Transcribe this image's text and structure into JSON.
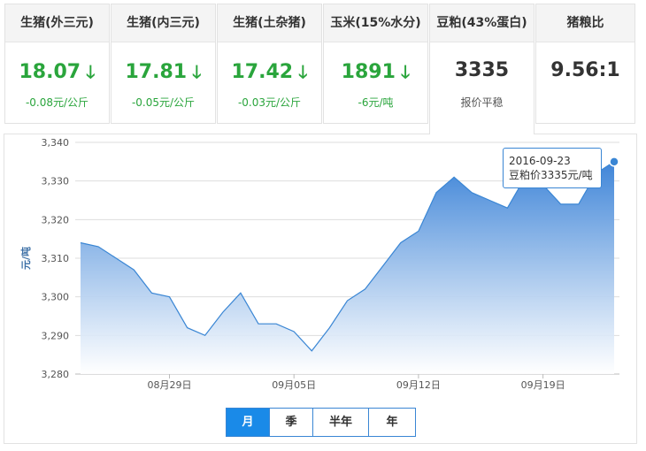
{
  "cards": [
    {
      "title": "生猪(外三元)",
      "value": "18.07",
      "change": "-0.08元/公斤",
      "trend": "down"
    },
    {
      "title": "生猪(内三元)",
      "value": "17.81",
      "change": "-0.05元/公斤",
      "trend": "down"
    },
    {
      "title": "生猪(土杂猪)",
      "value": "17.42",
      "change": "-0.03元/公斤",
      "trend": "down"
    },
    {
      "title": "玉米(15%水分)",
      "value": "1891",
      "change": "-6元/吨",
      "trend": "down"
    },
    {
      "title": "豆粕(43%蛋白)",
      "value": "3335",
      "change": "报价平稳",
      "trend": "flat"
    },
    {
      "title": "猪粮比",
      "value": "9.56:1",
      "change": "",
      "trend": "flat"
    }
  ],
  "icons": {
    "down_arrow": "arrow-down-icon"
  },
  "colors": {
    "accent": "#1a8ae8",
    "down": "#2aa53c",
    "line": "#3a86d4"
  },
  "chart_data": {
    "type": "area",
    "ylabel": "元/吨",
    "ylim": [
      3280,
      3340
    ],
    "yticks": [
      "3,340",
      "3,330",
      "3,320",
      "3,310",
      "3,300",
      "3,290",
      "3,280"
    ],
    "xtick_labels": [
      "08月29日",
      "09月05日",
      "09月12日",
      "09月19日"
    ],
    "x": [
      "08-24",
      "08-25",
      "08-26",
      "08-27",
      "08-28",
      "08-29",
      "08-30",
      "08-31",
      "09-01",
      "09-02",
      "09-03",
      "09-04",
      "09-05",
      "09-06",
      "09-07",
      "09-08",
      "09-09",
      "09-10",
      "09-11",
      "09-12",
      "09-13",
      "09-14",
      "09-15",
      "09-16",
      "09-17",
      "09-18",
      "09-19",
      "09-20",
      "09-21",
      "09-22",
      "09-23"
    ],
    "values": [
      3314,
      3313,
      3310,
      3307,
      3301,
      3300,
      3292,
      3290,
      3296,
      3301,
      3293,
      3293,
      3291,
      3286,
      3292,
      3299,
      3302,
      3308,
      3314,
      3317,
      3327,
      3331,
      3327,
      3325,
      3323,
      3331,
      3329,
      3324,
      3324,
      3332,
      3335
    ],
    "grid": true,
    "tooltip": {
      "date": "2016-09-23",
      "text": "豆粕价3335元/吨"
    }
  },
  "periods": [
    {
      "label": "月",
      "active": true
    },
    {
      "label": "季",
      "active": false
    },
    {
      "label": "半年",
      "active": false
    },
    {
      "label": "年",
      "active": false
    }
  ]
}
